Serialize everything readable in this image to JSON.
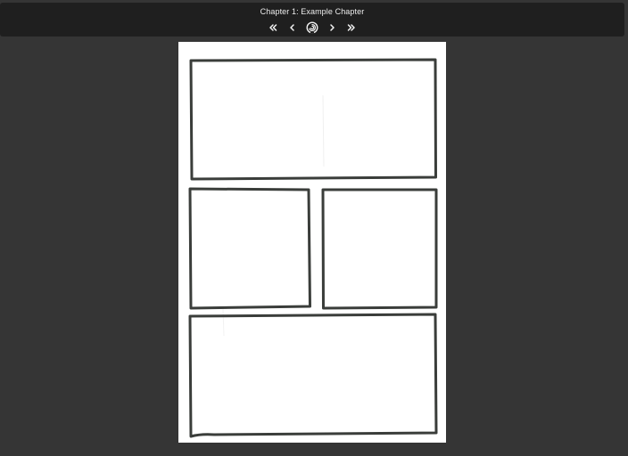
{
  "header": {
    "chapter_title": "Chapter 1: Example Chapter"
  },
  "nav": {
    "first_icon": "double-chevron-left-icon",
    "prev_icon": "chevron-left-icon",
    "center_icon": "spiral-icon",
    "next_icon": "chevron-right-icon",
    "last_icon": "double-chevron-right-icon"
  },
  "page": {
    "panel_count": 4
  },
  "colors": {
    "background": "#353535",
    "topbar": "#1f1f1f",
    "title_text": "#ececec",
    "page": "#ffffff",
    "ink": "#3a3d3a"
  }
}
